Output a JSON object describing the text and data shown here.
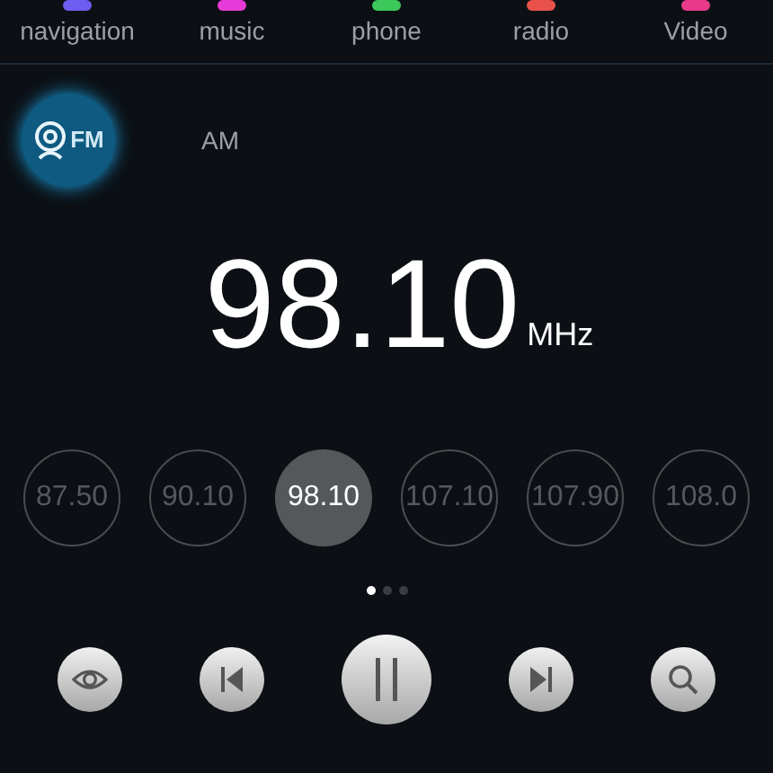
{
  "tabs": [
    {
      "label": "navigation",
      "color": "#6f5cf0"
    },
    {
      "label": "music",
      "color": "#e83ad8"
    },
    {
      "label": "phone",
      "color": "#3cc85a"
    },
    {
      "label": "radio",
      "color": "#e8524a"
    },
    {
      "label": "Video",
      "color": "#e83a8a"
    }
  ],
  "bands": [
    {
      "label": "FM",
      "selected": true
    },
    {
      "label": "AM",
      "selected": false
    }
  ],
  "frequency": {
    "value": "98.10",
    "unit": "MHz"
  },
  "presets": [
    {
      "label": "87.50",
      "selected": false
    },
    {
      "label": "90.10",
      "selected": false
    },
    {
      "label": "98.10",
      "selected": true
    },
    {
      "label": "107.10",
      "selected": false
    },
    {
      "label": "107.90",
      "selected": false
    },
    {
      "label": "108.0",
      "selected": false
    }
  ],
  "pages": [
    {
      "selected": true
    },
    {
      "selected": false
    },
    {
      "selected": false
    }
  ],
  "controls": [
    {
      "kind": "view"
    },
    {
      "kind": "prev"
    },
    {
      "kind": "pause"
    },
    {
      "kind": "next"
    },
    {
      "kind": "search"
    }
  ]
}
